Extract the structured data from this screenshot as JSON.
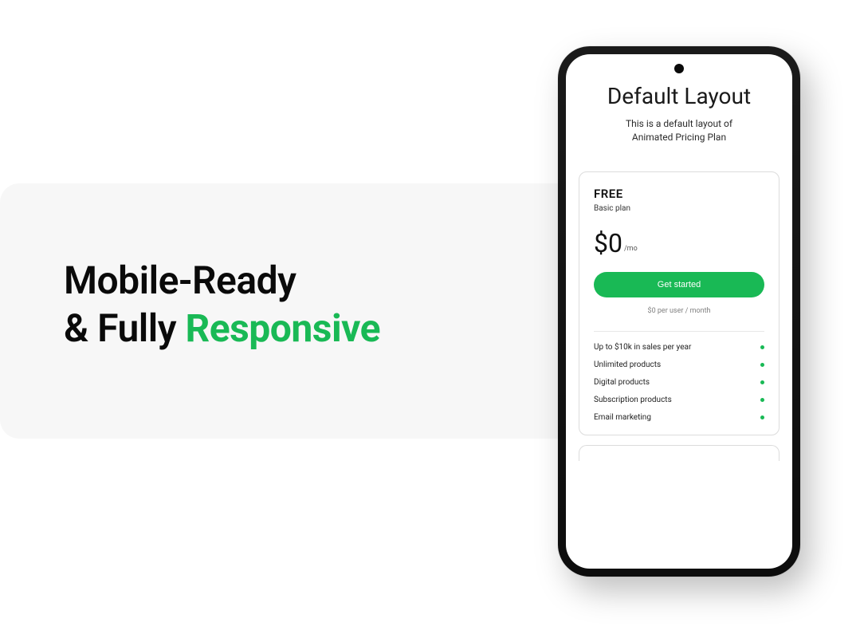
{
  "headline": {
    "line1": "Mobile-Ready",
    "line2_prefix": "& Fully ",
    "accent": "Responsive"
  },
  "screen": {
    "title": "Default Layout",
    "subtitle_l1": "This is a default layout of",
    "subtitle_l2": "Animated Pricing Plan"
  },
  "plan": {
    "name": "FREE",
    "label": "Basic plan",
    "price": "$0",
    "period": "/mo",
    "cta": "Get started",
    "note": "$0 per user / month",
    "features": [
      "Up to $10k in sales per year",
      "Unlimited products",
      "Digital products",
      "Subscription products",
      "Email marketing"
    ]
  },
  "colors": {
    "accent": "#19b955"
  }
}
